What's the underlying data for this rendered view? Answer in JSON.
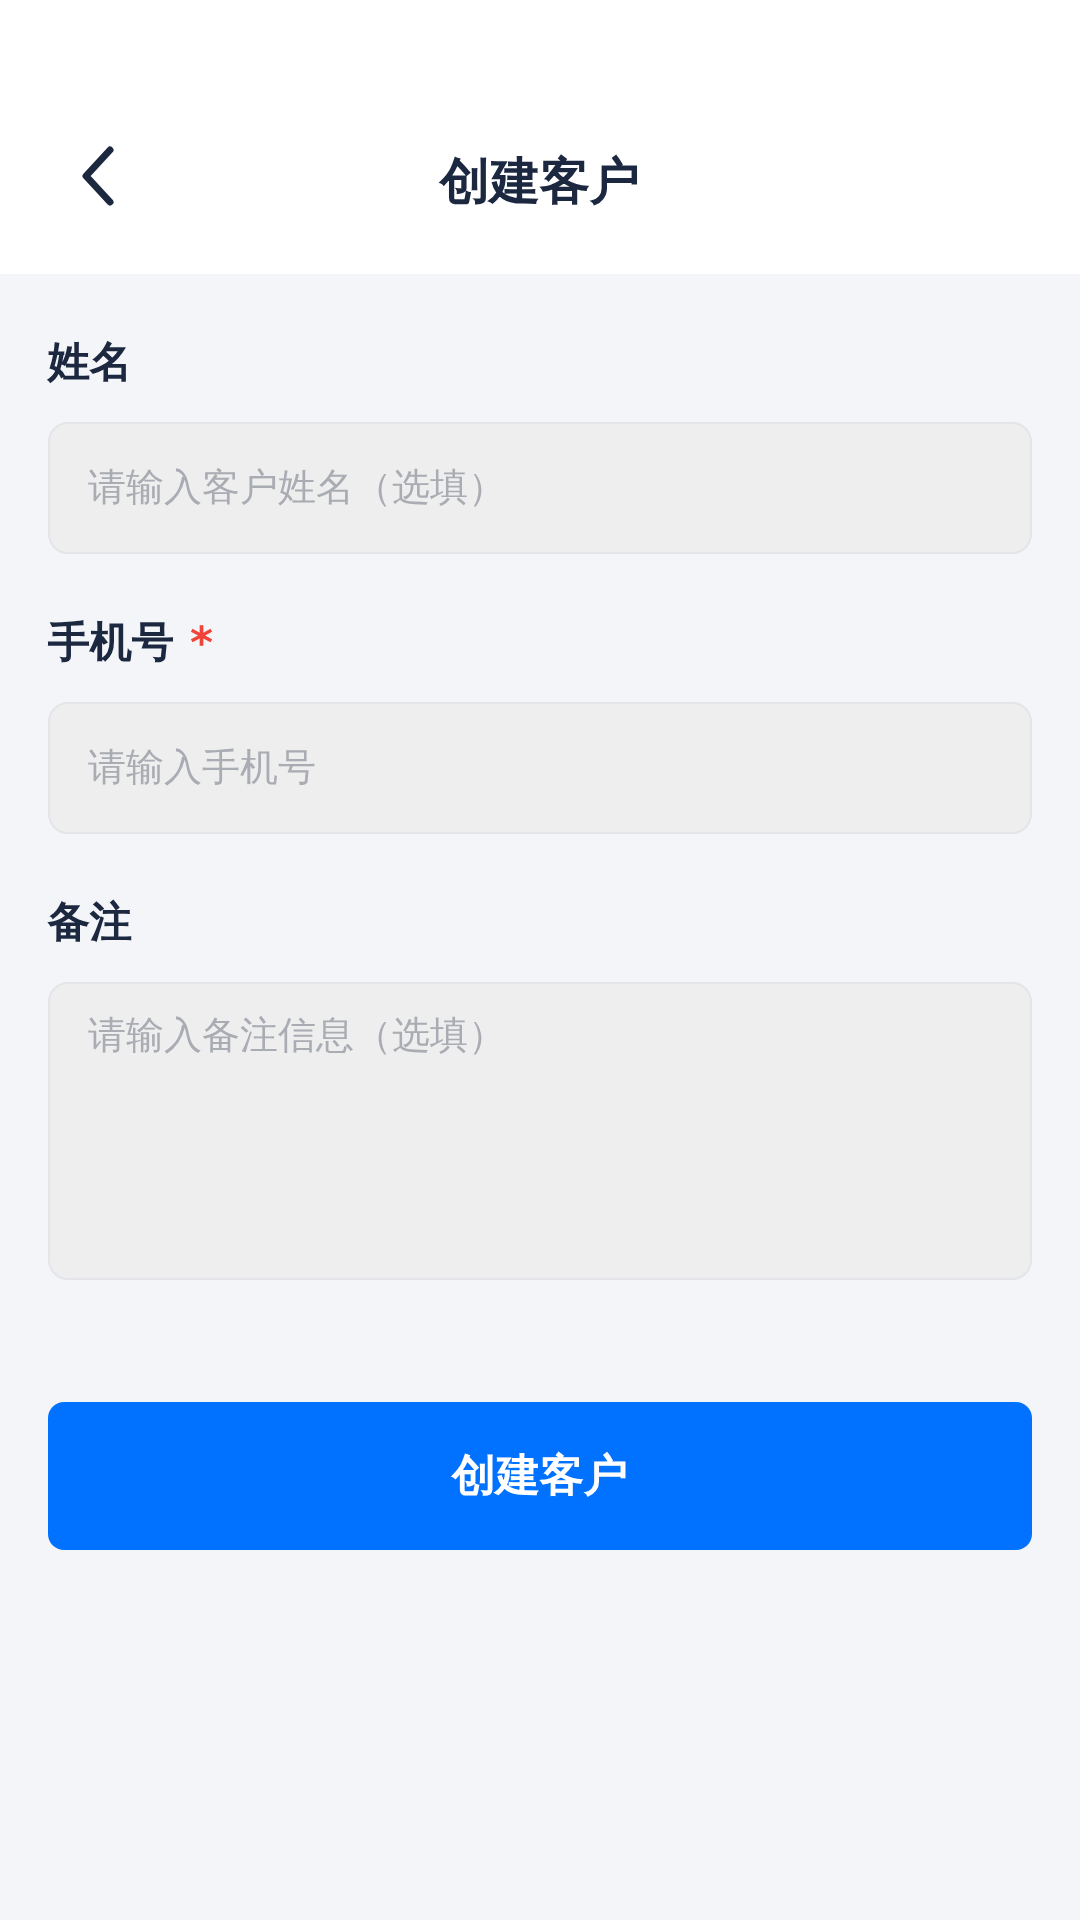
{
  "header": {
    "title": "创建客户"
  },
  "fields": [
    {
      "label": "姓名",
      "kind": "input",
      "placeholder": "请输入客户姓名（选填）"
    },
    {
      "label": "手机号",
      "required": true,
      "required_mark": "*",
      "kind": "input",
      "placeholder": "请输入手机号"
    },
    {
      "label": "备注",
      "kind": "textarea",
      "placeholder": "请输入备注信息（选填）"
    }
  ],
  "submit_button": "创建客户"
}
